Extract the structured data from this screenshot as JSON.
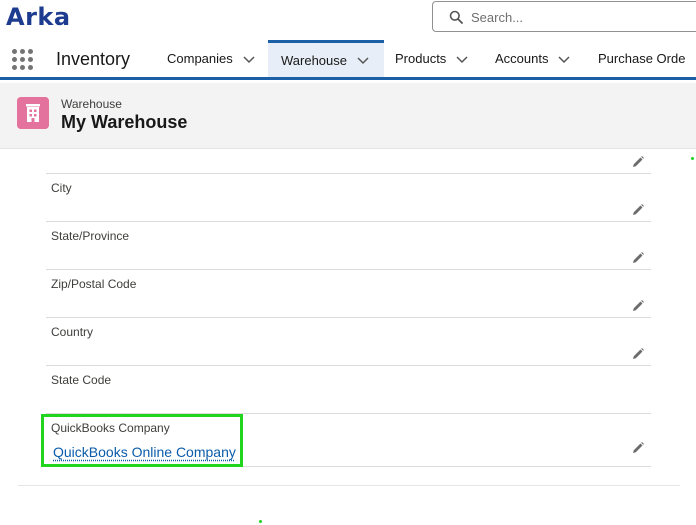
{
  "header": {
    "logo": "Arka",
    "search_placeholder": "Search..."
  },
  "nav": {
    "app_name": "Inventory",
    "items": [
      {
        "label": "Companies"
      },
      {
        "label": "Warehouse",
        "active": true
      },
      {
        "label": "Products"
      },
      {
        "label": "Accounts"
      },
      {
        "label": "Purchase Orde"
      }
    ]
  },
  "record": {
    "type": "Warehouse",
    "title": "My Warehouse",
    "icon": "warehouse-icon"
  },
  "fields": [
    {
      "label": "",
      "value": ""
    },
    {
      "label": "City",
      "value": ""
    },
    {
      "label": "State/Province",
      "value": ""
    },
    {
      "label": "Zip/Postal Code",
      "value": ""
    },
    {
      "label": "Country",
      "value": ""
    },
    {
      "label": "State Code",
      "value": ""
    },
    {
      "label": "QuickBooks Company",
      "value": "QuickBooks Online Company"
    }
  ],
  "colors": {
    "brand": "#1d3c8f",
    "nav_accent": "#1b5fa6",
    "record_icon": "#e3739c",
    "link": "#0b5cab",
    "highlight": "#21d41d"
  }
}
